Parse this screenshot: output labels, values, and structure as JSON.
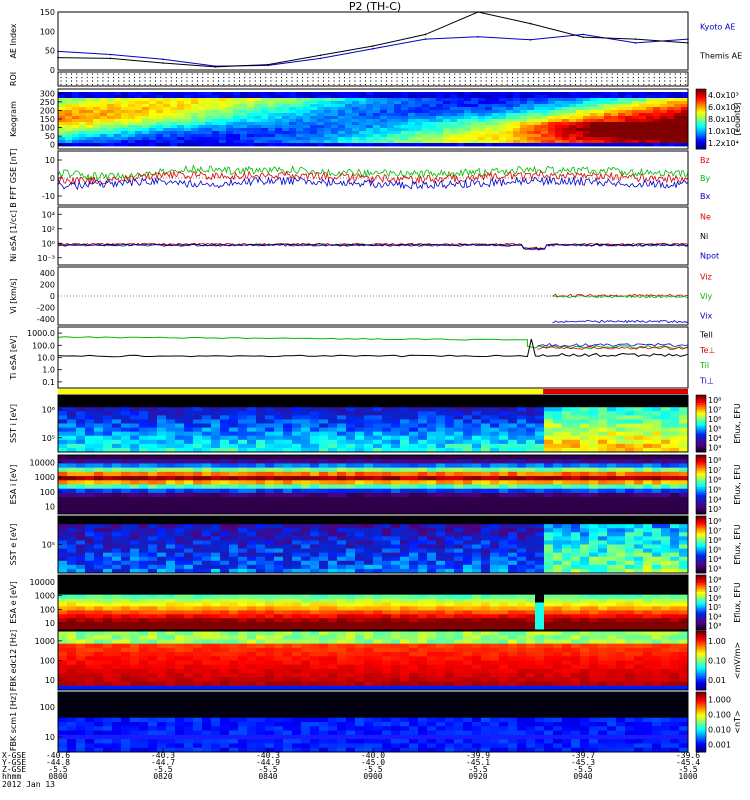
{
  "title": "P2 (TH-C)",
  "time_axis": {
    "row_labels": [
      "X-GSE",
      "Y-GSE",
      "Z-GSE",
      "hhmm",
      "2012 Jan 13"
    ],
    "columns": [
      {
        "x": "-40.6",
        "y": "-44.8",
        "z": "-5.5",
        "t": "0800"
      },
      {
        "x": "-40.3",
        "y": "-44.7",
        "z": "-5.5",
        "t": "0820"
      },
      {
        "x": "-40.3",
        "y": "-44.9",
        "z": "-5.5",
        "t": "0840"
      },
      {
        "x": "-40.0",
        "y": "-45.0",
        "z": "-5.5",
        "t": "0900"
      },
      {
        "x": "-39.9",
        "y": "-45.1",
        "z": "-5.5",
        "t": "0920"
      },
      {
        "x": "-39.7",
        "y": "-45.3",
        "z": "-5.5",
        "t": "0940"
      },
      {
        "x": "-39.6",
        "y": "-45.4",
        "z": "-5.5",
        "t": "1000"
      }
    ]
  },
  "chart_data": [
    {
      "type": "line",
      "panel": "ae",
      "ylabel": "AE Index",
      "yticks": [
        "0",
        "50",
        "100",
        "150"
      ],
      "ylim": [
        0,
        150
      ],
      "legend": [
        {
          "name": "Kyoto AE",
          "color": "#0000cc"
        },
        {
          "name": "Themis AE",
          "color": "#000000"
        }
      ],
      "x": [
        0,
        10,
        20,
        30,
        40,
        50,
        60,
        70,
        80,
        90,
        100,
        110,
        120
      ],
      "series": [
        {
          "name": "Kyoto AE",
          "color": "#0000cc",
          "values": [
            48,
            40,
            28,
            10,
            12,
            30,
            55,
            80,
            86,
            78,
            92,
            70,
            80
          ]
        },
        {
          "name": "Themis AE",
          "color": "#000000",
          "values": [
            32,
            30,
            18,
            8,
            14,
            38,
            62,
            92,
            150,
            120,
            85,
            80,
            70
          ]
        }
      ]
    },
    {
      "type": "bar",
      "panel": "roi",
      "ylabel": "ROI"
    },
    {
      "type": "heatmap",
      "panel": "keogram",
      "ylabel": "Keogram",
      "yticks": [
        "0",
        "50",
        "100",
        "150",
        "200",
        "250",
        "300"
      ],
      "ylim": [
        0,
        300
      ],
      "colorbar": {
        "label": "[counts]",
        "ticks": [
          "1.2x10⁴",
          "1.0x10⁴",
          "8.0x10³",
          "6.0x10³",
          "4.0x10³"
        ]
      }
    },
    {
      "type": "line",
      "panel": "bfield",
      "ylabel": "B FFT GSE [nT]",
      "yticks": [
        "-10",
        "0",
        "10"
      ],
      "ylim": [
        -12,
        12
      ],
      "legend": [
        {
          "name": "Bz",
          "color": "#dd0000"
        },
        {
          "name": "By",
          "color": "#00bb00"
        },
        {
          "name": "Bx",
          "color": "#0000cc"
        }
      ]
    },
    {
      "type": "line",
      "panel": "density",
      "ylabel": "Ni eSA [1/cc]",
      "yticks": [
        "10⁻³",
        "10⁰",
        "10²",
        "10⁴"
      ],
      "legend": [
        {
          "name": "Ne",
          "color": "#dd0000"
        },
        {
          "name": "Ni",
          "color": "#000000"
        },
        {
          "name": "Npot",
          "color": "#0000cc"
        }
      ]
    },
    {
      "type": "line",
      "panel": "velocity",
      "ylabel": "Vi [km/s]",
      "yticks": [
        "-400",
        "-200",
        "0",
        "200",
        "400"
      ],
      "ylim": [
        -500,
        500
      ],
      "legend": [
        {
          "name": "Viz",
          "color": "#dd0000"
        },
        {
          "name": "Viy",
          "color": "#00bb00"
        },
        {
          "name": "Vix",
          "color": "#0000cc"
        }
      ]
    },
    {
      "type": "line",
      "panel": "temperature",
      "ylabel": "Ti eSA [eV]",
      "yticks": [
        "0.1",
        "1.0",
        "10.0",
        "100.0",
        "1000.0"
      ],
      "legend": [
        {
          "name": "Tell",
          "color": "#000000"
        },
        {
          "name": "Te⊥",
          "color": "#dd0000"
        },
        {
          "name": "Til",
          "color": "#00bb00"
        },
        {
          "name": "Ti⊥",
          "color": "#0000cc"
        }
      ]
    },
    {
      "type": "heatmap",
      "panel": "sst-ion",
      "ylabel": "SST i [eV]",
      "yticks": [
        "10⁵",
        "10⁶"
      ],
      "colorbar": {
        "label": "Eflux, EFU",
        "ticks": [
          "10³",
          "10⁴",
          "10⁵",
          "10⁶",
          "10⁷",
          "10⁸"
        ]
      }
    },
    {
      "type": "heatmap",
      "panel": "esa-ion",
      "ylabel": "ESA i [eV]",
      "yticks": [
        "10",
        "100",
        "1000",
        "10000"
      ],
      "colorbar": {
        "label": "Eflux, EFU",
        "ticks": [
          "10³",
          "10⁴",
          "10⁵",
          "10⁶",
          "10⁷",
          "10⁸"
        ]
      }
    },
    {
      "type": "heatmap",
      "panel": "sst-elec",
      "ylabel": "SST e [eV]",
      "yticks": [
        "10⁵"
      ],
      "colorbar": {
        "label": "Eflux, EFU",
        "ticks": [
          "10³",
          "10⁴",
          "10⁵",
          "10⁶",
          "10⁷",
          "10⁸"
        ]
      }
    },
    {
      "type": "heatmap",
      "panel": "esa-elec",
      "ylabel": "ESA e [eV]",
      "yticks": [
        "10",
        "100",
        "1000",
        "10000"
      ],
      "colorbar": {
        "label": "Eflux, EFU",
        "ticks": [
          "10³",
          "10⁴",
          "10⁵",
          "10⁶",
          "10⁷",
          "10⁸"
        ]
      }
    },
    {
      "type": "heatmap",
      "panel": "fbk-e",
      "ylabel": "FBK edc12 [Hz]",
      "yticks": [
        "10",
        "100",
        "1000"
      ],
      "colorbar": {
        "label": "<mV/m>",
        "ticks": [
          "0.01",
          "0.10",
          "1.00"
        ]
      }
    },
    {
      "type": "heatmap",
      "panel": "fbk-b",
      "ylabel": "FBK scm1 [Hz]",
      "yticks": [
        "10",
        "100"
      ],
      "colorbar": {
        "label": "<nT>",
        "ticks": [
          "0.001",
          "0.010",
          "0.100",
          "1.000"
        ]
      }
    }
  ]
}
